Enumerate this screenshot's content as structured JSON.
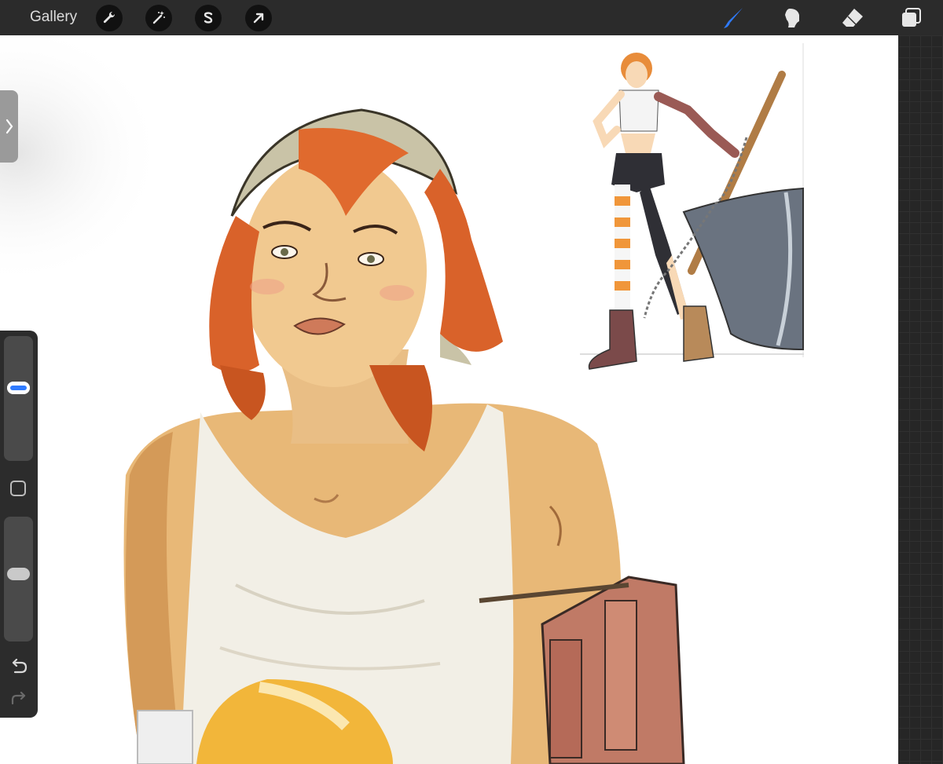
{
  "topbar": {
    "gallery_label": "Gallery",
    "left_tools": [
      {
        "name": "wrench-icon",
        "purpose": "actions"
      },
      {
        "name": "magic-wand-icon",
        "purpose": "adjustments"
      },
      {
        "name": "selection-s-icon",
        "purpose": "selection"
      },
      {
        "name": "transform-arrow-icon",
        "purpose": "transform"
      }
    ],
    "right_tools": [
      {
        "name": "brush-icon",
        "purpose": "paint",
        "active": true
      },
      {
        "name": "smudge-icon",
        "purpose": "smudge"
      },
      {
        "name": "eraser-icon",
        "purpose": "erase"
      },
      {
        "name": "layers-icon",
        "purpose": "layers"
      }
    ]
  },
  "colors": {
    "topbar_bg": "#2b2b2b",
    "active_tool": "#2f7bff",
    "inactive_icon": "#e6e6e6",
    "canvas_bg": "#ffffff",
    "hair": "#d9622a",
    "skin": "#f0c98f",
    "tank_top": "#f2efe6"
  },
  "sidebar": {
    "brush_size_level": 0.6,
    "opacity_level": 0.55,
    "undo_icon": "undo-arrow-icon",
    "redo_icon": "redo-arrow-icon",
    "modify_icon": "square-modify-icon"
  },
  "side_tab_icon": "chevron-right-icon"
}
